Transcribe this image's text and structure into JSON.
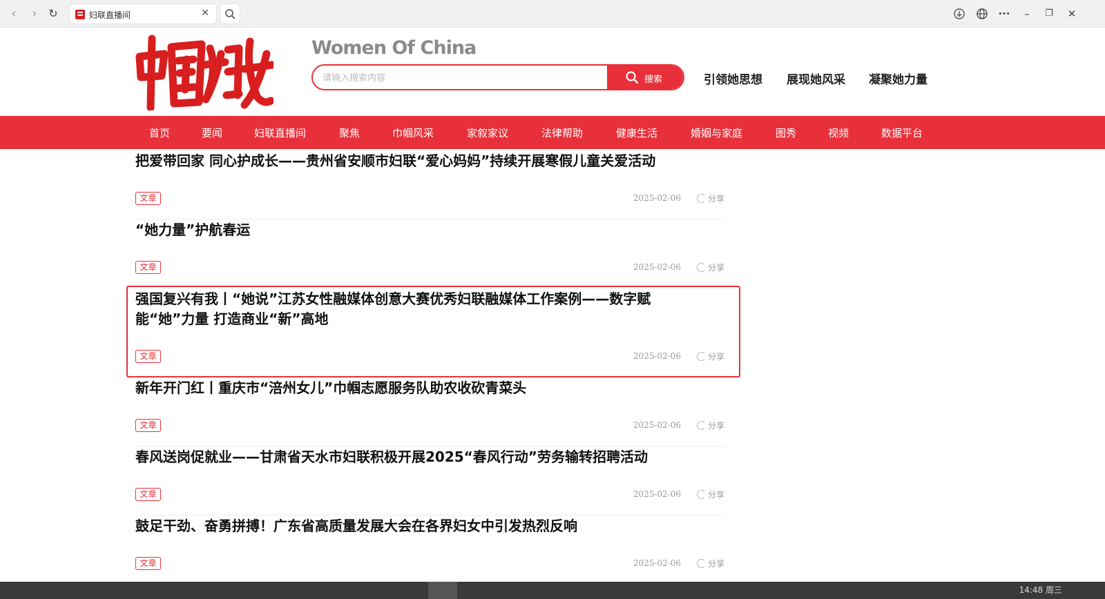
{
  "browser": {
    "tab_title": "妇联直播间",
    "tab_close": "✕",
    "back_glyph": "‹",
    "forward_glyph": "›",
    "reload_glyph": "↻",
    "menu_glyph": "···",
    "minimize_glyph": "–",
    "restore_glyph": "❐",
    "close_glyph": "✕"
  },
  "header": {
    "logo_text": "中国妇女",
    "wordmark": "Women Of China",
    "search": {
      "placeholder": "请输入搜索内容",
      "value": "",
      "button_label": "搜索"
    },
    "links": [
      "引领她思想",
      "展现她风采",
      "凝聚她力量"
    ]
  },
  "nav": {
    "items": [
      "首页",
      "要闻",
      "妇联直播间",
      "聚焦",
      "巾帼风采",
      "家叙家议",
      "法律帮助",
      "健康生活",
      "婚姻与家庭",
      "图秀",
      "视频",
      "数据平台"
    ]
  },
  "articles": [
    {
      "title": "把爱带回家 同心护成长——贵州省安顺市妇联“爱心妈妈”持续开展寒假儿童关爱活动",
      "tag": "文章",
      "date": "2025-02-06",
      "share": "分享"
    },
    {
      "title": "“她力量”护航春运",
      "tag": "文章",
      "date": "2025-02-06",
      "share": "分享"
    },
    {
      "title": "强国复兴有我丨“她说”江苏女性融媒体创意大赛优秀妇联融媒体工作案例——数字赋能“她”力量 打造商业“新”高地",
      "tag": "文章",
      "date": "2025-02-06",
      "share": "分享"
    },
    {
      "title": "新年开门红丨重庆市“涪州女儿”巾帼志愿服务队助农收砍青菜头",
      "tag": "文章",
      "date": "2025-02-06",
      "share": "分享"
    },
    {
      "title": "春风送岗促就业——甘肃省天水市妇联积极开展2025“春风行动”劳务输转招聘活动",
      "tag": "文章",
      "date": "2025-02-06",
      "share": "分享"
    },
    {
      "title": "鼓足干劲、奋勇拼搏！广东省高质量发展大会在各界妇女中引发热烈反响",
      "tag": "文章",
      "date": "2025-02-06",
      "share": "分享"
    }
  ],
  "colors": {
    "accent": "#e8303a",
    "muted": "#999999",
    "title": "#111111"
  },
  "taskbar": {
    "clock": "14:48 周三"
  }
}
